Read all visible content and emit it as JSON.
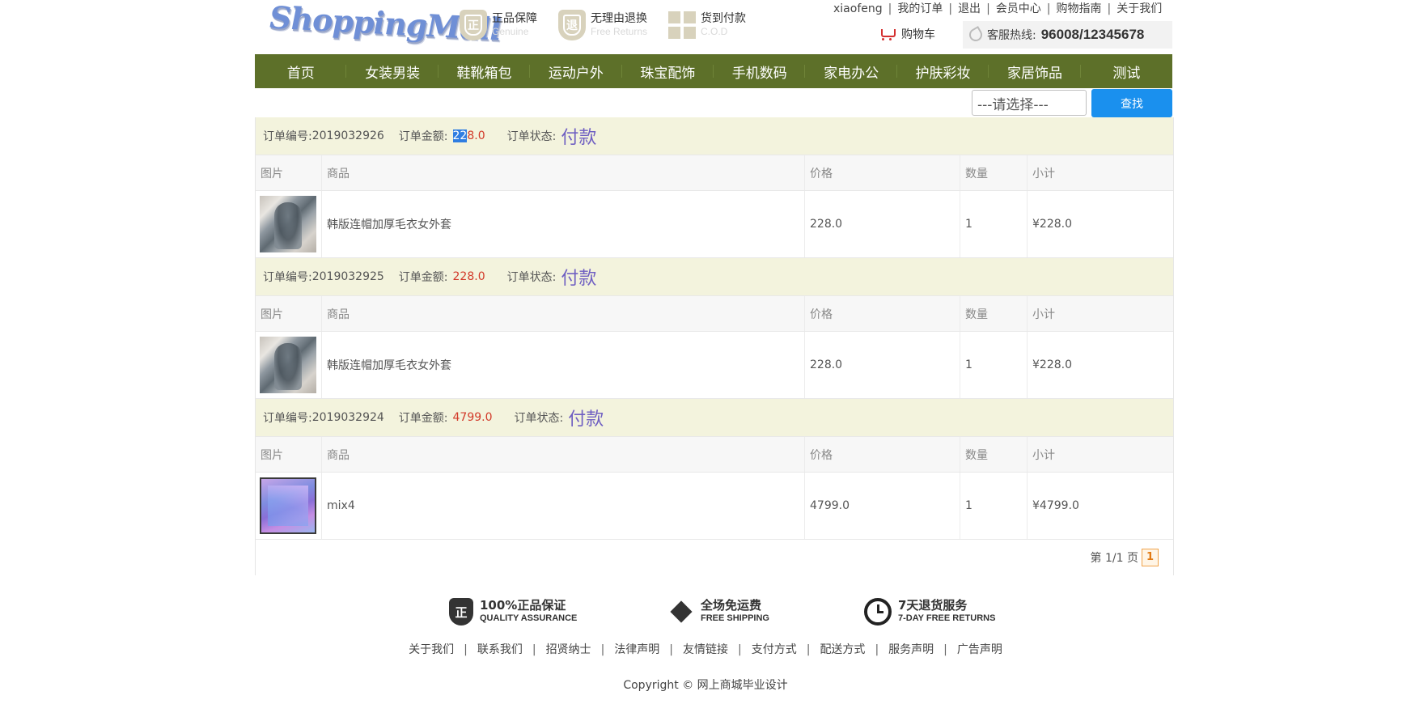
{
  "header": {
    "logo": "ShoppingMall",
    "badges": [
      {
        "icon": "shield-zheng-icon",
        "glyph": "正",
        "title": "正品保障",
        "subtitle": "Genuine"
      },
      {
        "icon": "shield-return-icon",
        "glyph": "退",
        "title": "无理由退换",
        "subtitle": "Free Returns"
      },
      {
        "icon": "gift-box-icon",
        "title": "货到付款",
        "subtitle": "C.O.D"
      }
    ],
    "top_links": [
      "xiaofeng",
      "我的订单",
      "退出",
      "会员中心",
      "购物指南",
      "关于我们"
    ],
    "cart_label": "购物车",
    "hotline_label": "客服热线:",
    "hotline_number": "96008/12345678"
  },
  "nav": [
    "首页",
    "女装男装",
    "鞋靴箱包",
    "运动户外",
    "珠宝配饰",
    "手机数码",
    "家电办公",
    "护肤彩妆",
    "家居饰品",
    "测试"
  ],
  "filter": {
    "select_value": "---请选择---",
    "search_button": "查找"
  },
  "labels": {
    "order_no": "订单编号:",
    "order_amount": "订单金额:",
    "order_status": "订单状态:",
    "columns": [
      "图片",
      "商品",
      "价格",
      "数量",
      "小计"
    ]
  },
  "orders": [
    {
      "number": "2019032926",
      "amount_selected": "22",
      "amount_rest": "8.0",
      "status": "付款",
      "item": {
        "image": "coat-thumbnail",
        "name": "韩版连帽加厚毛衣女外套",
        "price": "228.0",
        "qty": "1",
        "subtotal": "¥228.0"
      }
    },
    {
      "number": "2019032925",
      "amount": "228.0",
      "status": "付款",
      "item": {
        "image": "coat-thumbnail",
        "name": "韩版连帽加厚毛衣女外套",
        "price": "228.0",
        "qty": "1",
        "subtotal": "¥228.0"
      }
    },
    {
      "number": "2019032924",
      "amount": "4799.0",
      "status": "付款",
      "item": {
        "image": "phone-thumbnail",
        "name": "mix4",
        "price": "4799.0",
        "qty": "1",
        "subtotal": "¥4799.0"
      }
    }
  ],
  "pager": {
    "text": "第 1/1 页",
    "current": "1"
  },
  "footer": {
    "assurances": [
      {
        "icon": "shield-zheng-icon",
        "glyph": "正",
        "title": "100%正品保证",
        "subtitle": "QUALITY ASSURANCE"
      },
      {
        "icon": "box-icon",
        "title": "全场免运费",
        "subtitle": "FREE SHIPPING"
      },
      {
        "icon": "clock-icon",
        "title": "7天退货服务",
        "subtitle": "7-DAY FREE RETURNS"
      }
    ],
    "links": [
      "关于我们",
      "联系我们",
      "招贤纳士",
      "法律声明",
      "友情链接",
      "支付方式",
      "配送方式",
      "服务声明",
      "广告声明"
    ],
    "copyright": "Copyright © 网上商城毕业设计"
  }
}
